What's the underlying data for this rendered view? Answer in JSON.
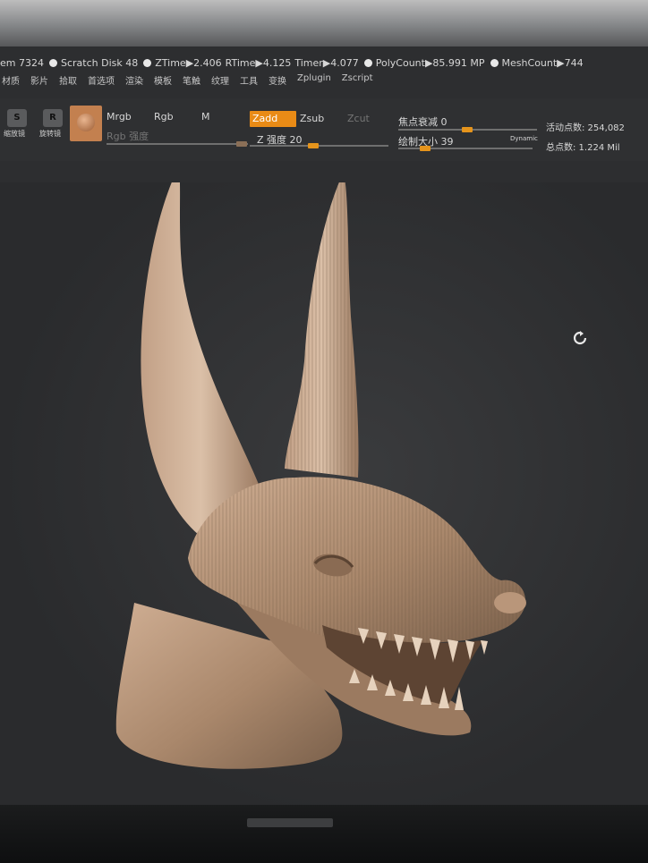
{
  "status": {
    "mem": "em 7324",
    "scratch": "Scratch Disk 48",
    "ztime": "ZTime▶2.406",
    "rtime": "RTime▶4.125",
    "timer": "Timer▶4.077",
    "polycount": "PolyCount▶85.991 MP",
    "meshcount": "MeshCount▶744"
  },
  "menu": [
    "材质",
    "影片",
    "拾取",
    "首选项",
    "渲染",
    "模板",
    "笔触",
    "纹理",
    "工具",
    "变换",
    "Zplugin",
    "Zscript"
  ],
  "toolbar": {
    "btn_s_label": "S",
    "btn_s_caption": "缩放镜",
    "btn_r_label": "R",
    "btn_r_caption": "旋转镜",
    "mrgb": "Mrgb",
    "rgb": "Rgb",
    "m": "M",
    "rgb_intensity": "Rgb 强度",
    "zadd": "Zadd",
    "zsub": "Zsub",
    "zcut": "Zcut",
    "z_intensity": "Z 强度 20",
    "focal_shift": "焦点衰减 0",
    "draw_size": "绘制大小 39",
    "dynamic": "Dynamic",
    "active_points": "活动点数: 254,082",
    "total_points": "总点数: 1.224 Mil"
  },
  "colors": {
    "accent": "#e98b16",
    "sculpt": "#b08a6c",
    "viewport": "#2d2e30"
  },
  "icons": [
    "refresh-icon",
    "material-sphere-icon"
  ]
}
